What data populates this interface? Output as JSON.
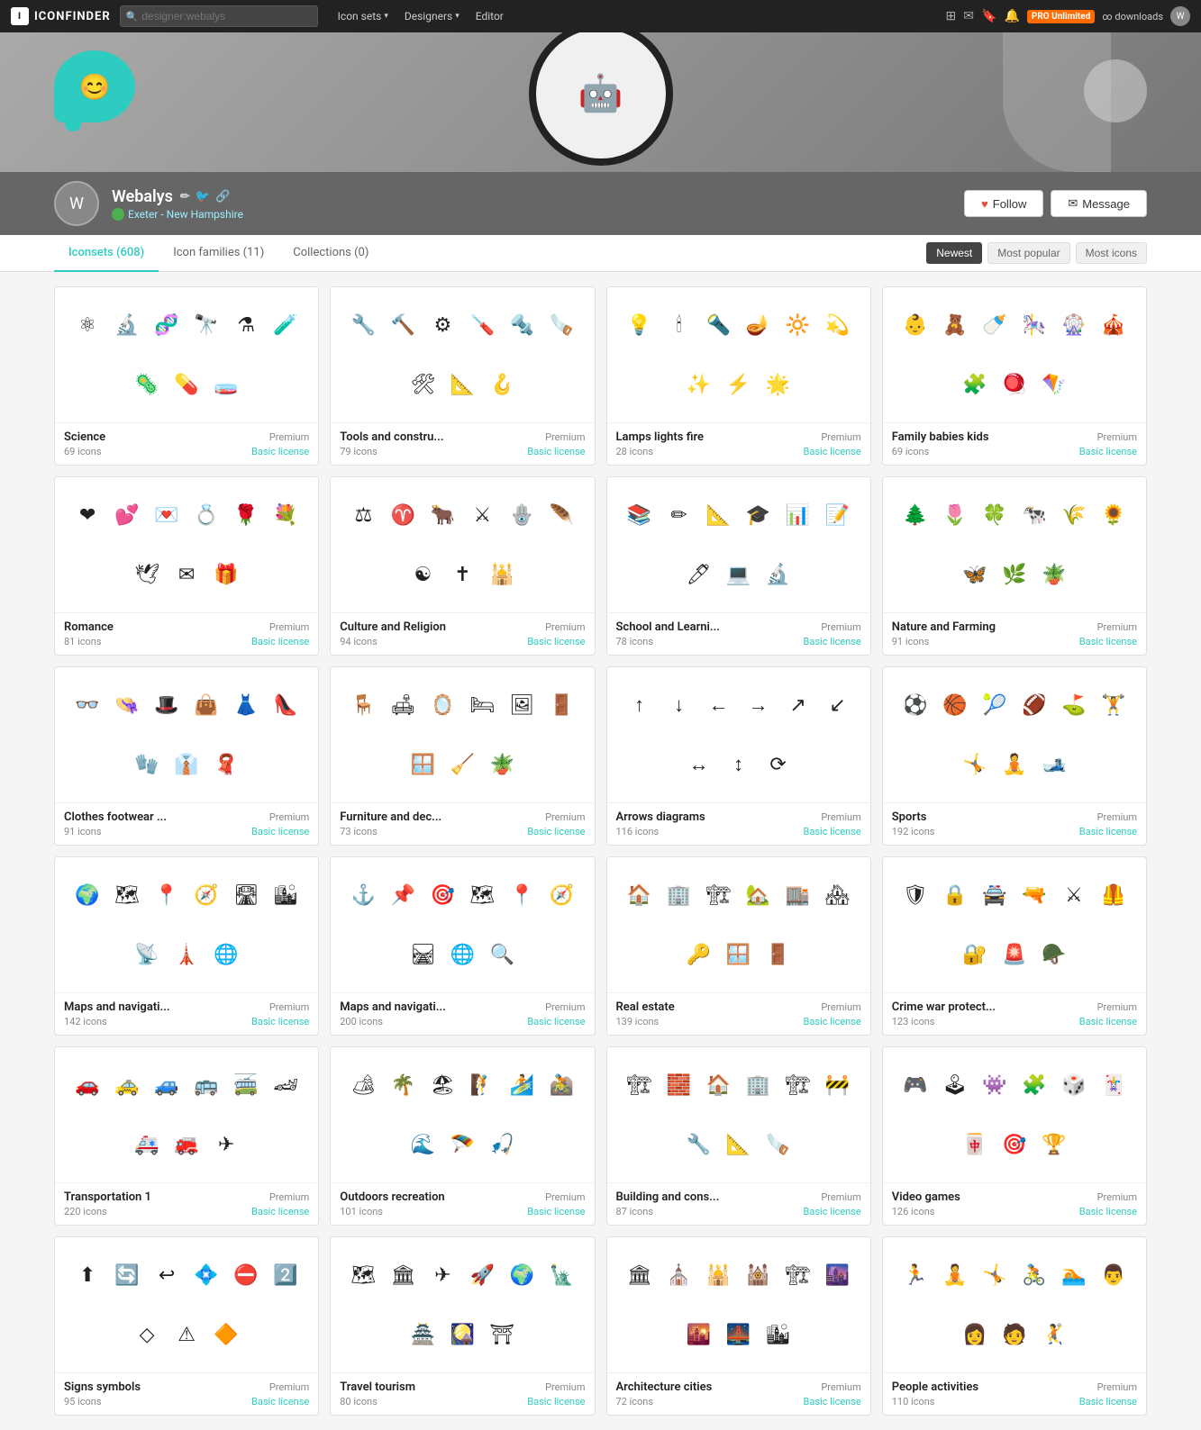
{
  "nav": {
    "brand": "ICONFINDER",
    "search_placeholder": "designer:webalys",
    "links": [
      {
        "label": "Icon sets",
        "has_dropdown": true
      },
      {
        "label": "Designers",
        "has_dropdown": true
      },
      {
        "label": "Editor",
        "has_dropdown": false
      }
    ],
    "pro_label": "PRO Unlimited",
    "pro_sub": "∞ downloads"
  },
  "profile": {
    "name": "Webalys",
    "location": "Exeter - New Hampshire",
    "follow_label": "Follow",
    "message_label": "Message"
  },
  "tabs": [
    {
      "label": "Iconsets (608)",
      "active": true
    },
    {
      "label": "Icon families (11)",
      "active": false
    },
    {
      "label": "Collections (0)",
      "active": false
    }
  ],
  "sort_buttons": [
    {
      "label": "Newest",
      "active": true
    },
    {
      "label": "Most popular",
      "active": false
    },
    {
      "label": "Most icons",
      "active": false
    }
  ],
  "cards": [
    {
      "title": "Science",
      "count": "69 icons",
      "license": "Basic license",
      "premium": "Premium",
      "icons": [
        "⚛",
        "🔬",
        "🧬",
        "🔭",
        "⚗",
        "🧪",
        "🦠",
        "💊",
        "🧫"
      ]
    },
    {
      "title": "Tools and constru...",
      "count": "79 icons",
      "license": "Basic license",
      "premium": "Premium",
      "icons": [
        "🔧",
        "🔨",
        "⚙",
        "🪛",
        "🔩",
        "🪚",
        "🛠",
        "📐",
        "🪝"
      ]
    },
    {
      "title": "Lamps lights fire",
      "count": "28 icons",
      "license": "Basic license",
      "premium": "Premium",
      "icons": [
        "💡",
        "🕯",
        "🔦",
        "🪔",
        "🔆",
        "💫",
        "✨",
        "⚡",
        "🌟"
      ]
    },
    {
      "title": "Family babies kids",
      "count": "69 icons",
      "license": "Basic license",
      "premium": "Premium",
      "icons": [
        "👶",
        "🧸",
        "🍼",
        "🎠",
        "🎡",
        "🎪",
        "🧩",
        "🪀",
        "🪁"
      ]
    },
    {
      "title": "Romance",
      "count": "81 icons",
      "license": "Basic license",
      "premium": "Premium",
      "icons": [
        "❤",
        "💕",
        "💌",
        "💍",
        "🌹",
        "💐",
        "🕊",
        "✉",
        "🎁"
      ]
    },
    {
      "title": "Culture and Religion",
      "count": "94 icons",
      "license": "Basic license",
      "premium": "Premium",
      "icons": [
        "⚖",
        "♈",
        "🐂",
        "⚔",
        "🪬",
        "🪶",
        "☯",
        "✝",
        "🕌"
      ]
    },
    {
      "title": "School and Learni...",
      "count": "78 icons",
      "license": "Basic license",
      "premium": "Premium",
      "icons": [
        "📚",
        "✏",
        "📐",
        "🎓",
        "📊",
        "📝",
        "🖊",
        "💻",
        "🔬"
      ]
    },
    {
      "title": "Nature and Farming",
      "count": "91 icons",
      "license": "Basic license",
      "premium": "Premium",
      "icons": [
        "🌲",
        "🌷",
        "🍀",
        "🐄",
        "🌾",
        "🌻",
        "🦋",
        "🌿",
        "🪴"
      ]
    },
    {
      "title": "Clothes footwear ...",
      "count": "91 icons",
      "license": "Basic license",
      "premium": "Premium",
      "icons": [
        "👓",
        "👒",
        "🎩",
        "👜",
        "👗",
        "👠",
        "🧤",
        "👔",
        "🧣"
      ]
    },
    {
      "title": "Furniture and dec...",
      "count": "73 icons",
      "license": "Basic license",
      "premium": "Premium",
      "icons": [
        "🪑",
        "🛋",
        "🪞",
        "🛏",
        "🖼",
        "🚪",
        "🪟",
        "🧹",
        "🪴"
      ]
    },
    {
      "title": "Arrows diagrams",
      "count": "116 icons",
      "license": "Basic license",
      "premium": "Premium",
      "icons": [
        "↑",
        "↓",
        "←",
        "→",
        "↗",
        "↙",
        "↔",
        "↕",
        "⟳"
      ]
    },
    {
      "title": "Sports",
      "count": "192 icons",
      "license": "Basic license",
      "premium": "Premium",
      "icons": [
        "⚽",
        "🏀",
        "🎾",
        "🏈",
        "⛳",
        "🏋",
        "🤸",
        "🧘",
        "🎿"
      ]
    },
    {
      "title": "Maps and navigati...",
      "count": "142 icons",
      "license": "Basic license",
      "premium": "Premium",
      "icons": [
        "🌍",
        "🗺",
        "📍",
        "🧭",
        "🛣",
        "🏙",
        "📡",
        "🗼",
        "🌐"
      ]
    },
    {
      "title": "Maps and navigati...",
      "count": "200 icons",
      "license": "Basic license",
      "premium": "Premium",
      "icons": [
        "⚓",
        "📌",
        "🎯",
        "🗺",
        "📍",
        "🧭",
        "🛤",
        "🌐",
        "🔍"
      ]
    },
    {
      "title": "Real estate",
      "count": "139 icons",
      "license": "Basic license",
      "premium": "Premium",
      "icons": [
        "🏠",
        "🏢",
        "🏗",
        "🏡",
        "🏬",
        "🏘",
        "🔑",
        "🪟",
        "🚪"
      ]
    },
    {
      "title": "Crime war protect...",
      "count": "123 icons",
      "license": "Basic license",
      "premium": "Premium",
      "icons": [
        "🛡",
        "🔒",
        "🚔",
        "🔫",
        "⚔",
        "🦺",
        "🔐",
        "🚨",
        "🪖"
      ]
    },
    {
      "title": "Transportation 1",
      "count": "220 icons",
      "license": "Basic license",
      "premium": "Premium",
      "icons": [
        "🚗",
        "🚕",
        "🚙",
        "🚌",
        "🚎",
        "🏎",
        "🚑",
        "🚒",
        "✈"
      ]
    },
    {
      "title": "Outdoors recreation",
      "count": "101 icons",
      "license": "Basic license",
      "premium": "Premium",
      "icons": [
        "🏕",
        "🌴",
        "🏖",
        "🧗",
        "🏄",
        "🚵",
        "🌊",
        "🪂",
        "🎣"
      ]
    },
    {
      "title": "Building and cons...",
      "count": "87 icons",
      "license": "Basic license",
      "premium": "Premium",
      "icons": [
        "🏗",
        "🧱",
        "🏠",
        "🏢",
        "🏗",
        "🚧",
        "🔧",
        "📐",
        "🪚"
      ]
    },
    {
      "title": "Video games",
      "count": "126 icons",
      "license": "Basic license",
      "premium": "Premium",
      "icons": [
        "🎮",
        "🕹",
        "👾",
        "🧩",
        "🎲",
        "🃏",
        "🀄",
        "🎯",
        "🏆"
      ]
    },
    {
      "title": "Signs symbols",
      "count": "95 icons",
      "license": "Basic license",
      "premium": "Premium",
      "icons": [
        "⬆",
        "🔄",
        "↩",
        "💠",
        "⛔",
        "2️⃣",
        "◇",
        "⚠",
        "🔶"
      ]
    },
    {
      "title": "Travel tourism",
      "count": "80 icons",
      "license": "Basic license",
      "premium": "Premium",
      "icons": [
        "🗺",
        "🏛",
        "✈",
        "🚀",
        "🌍",
        "🗽",
        "🏯",
        "🎑",
        "⛩"
      ]
    },
    {
      "title": "Architecture cities",
      "count": "72 icons",
      "license": "Basic license",
      "premium": "Premium",
      "icons": [
        "🏛",
        "⛪",
        "🕌",
        "🕍",
        "🏗",
        "🌆",
        "🌇",
        "🌉",
        "🏙"
      ]
    },
    {
      "title": "People activities",
      "count": "110 icons",
      "license": "Basic license",
      "premium": "Premium",
      "icons": [
        "🏃",
        "🧘",
        "🤸",
        "🚴",
        "🏊",
        "👨",
        "👩",
        "🧑",
        "🤾"
      ]
    }
  ]
}
